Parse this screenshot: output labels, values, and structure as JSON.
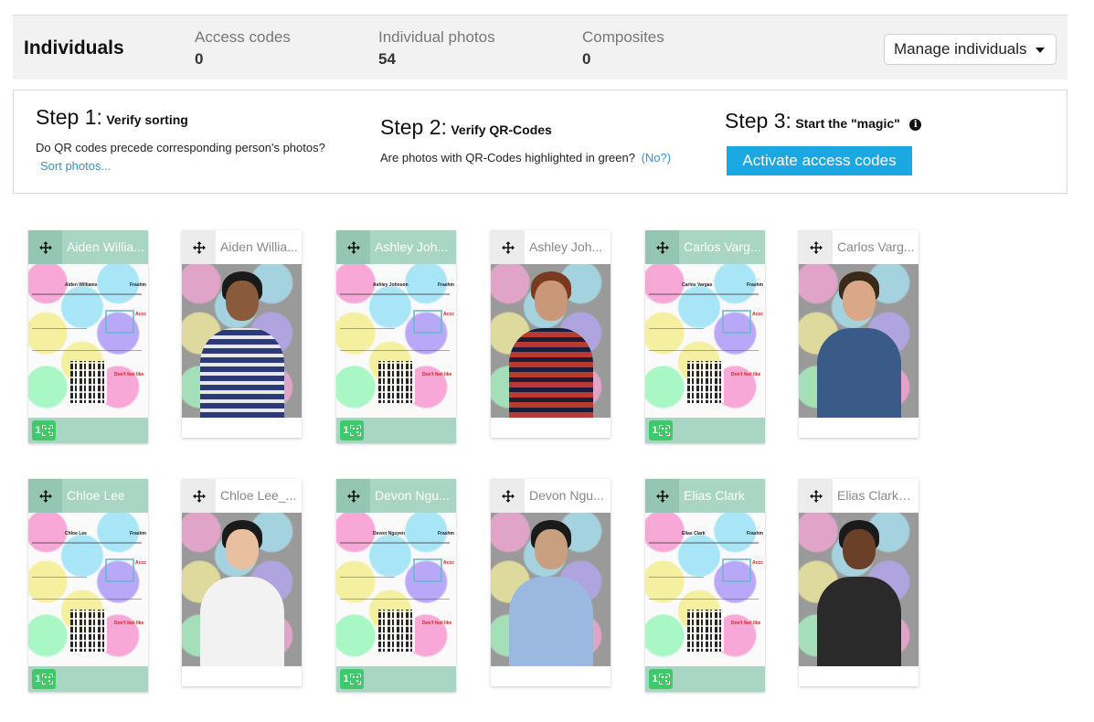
{
  "header": {
    "title": "Individuals",
    "stats": [
      {
        "label": "Access codes",
        "value": "0"
      },
      {
        "label": "Individual photos",
        "value": "54"
      },
      {
        "label": "Composites",
        "value": "0"
      }
    ],
    "manage_button": "Manage individuals"
  },
  "steps": {
    "step1": {
      "num": "Step 1:",
      "title": "Verify sorting",
      "desc": "Do QR codes precede corresponding person's photos?",
      "link": "Sort photos..."
    },
    "step2": {
      "num": "Step 2:",
      "title": "Verify QR-Codes",
      "desc": "Are photos with QR-Codes highlighted in green?",
      "link": "(No?)"
    },
    "step3": {
      "num": "Step 3:",
      "title": "Start the \"magic\"",
      "button": "Activate access codes"
    }
  },
  "colors": {
    "accent": "#1aa7e2",
    "qr_card": "#a8d5c4",
    "qr_badge": "#3fc96a",
    "link": "#3a8fc8"
  },
  "cards": [
    {
      "name": "Aiden Willia...",
      "type": "qr",
      "qr_count": "1",
      "sheet_name": "Aiden Williams"
    },
    {
      "name": "Aiden Willia...",
      "type": "photo"
    },
    {
      "name": "Ashley Joh...",
      "type": "qr",
      "qr_count": "1",
      "sheet_name": "Ashley Johnson"
    },
    {
      "name": "Ashley Joh...",
      "type": "photo"
    },
    {
      "name": "Carlos Varg...",
      "type": "qr",
      "qr_count": "1",
      "sheet_name": "Carlos Vargas"
    },
    {
      "name": "Carlos Varg...",
      "type": "photo"
    },
    {
      "name": "Chloe Lee",
      "type": "qr",
      "qr_count": "1",
      "sheet_name": "Chloe Lee"
    },
    {
      "name": "Chloe Lee_...",
      "type": "photo"
    },
    {
      "name": "Devon Ngu...",
      "type": "qr",
      "qr_count": "1",
      "sheet_name": "Devon Nguyen"
    },
    {
      "name": "Devon Ngu...",
      "type": "photo"
    },
    {
      "name": "Elias Clark",
      "type": "qr",
      "qr_count": "1",
      "sheet_name": "Elias Clark"
    },
    {
      "name": "Elias Clark_...",
      "type": "photo"
    }
  ],
  "sheet": {
    "line1": "Accc",
    "line2": "Frashm",
    "line3": "Don't feel like"
  }
}
